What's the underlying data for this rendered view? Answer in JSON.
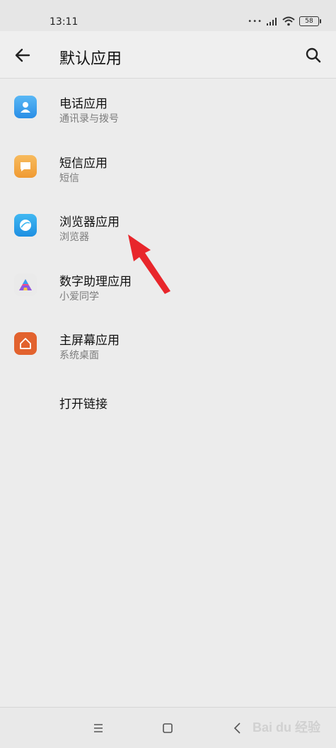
{
  "status_bar": {
    "time": "13:11",
    "battery": "58"
  },
  "header": {
    "title": "默认应用"
  },
  "items": [
    {
      "title": "电话应用",
      "subtitle": "通讯录与拨号",
      "icon": "phone-contacts-icon"
    },
    {
      "title": "短信应用",
      "subtitle": "短信",
      "icon": "sms-icon"
    },
    {
      "title": "浏览器应用",
      "subtitle": "浏览器",
      "icon": "browser-icon"
    },
    {
      "title": "数字助理应用",
      "subtitle": "小爱同学",
      "icon": "assistant-icon"
    },
    {
      "title": "主屏幕应用",
      "subtitle": "系统桌面",
      "icon": "home-launcher-icon"
    },
    {
      "title": "打开链接"
    }
  ],
  "watermark": "Bai du 经验",
  "colors": {
    "accent_arrow": "#e8262b",
    "background": "#ececec"
  }
}
